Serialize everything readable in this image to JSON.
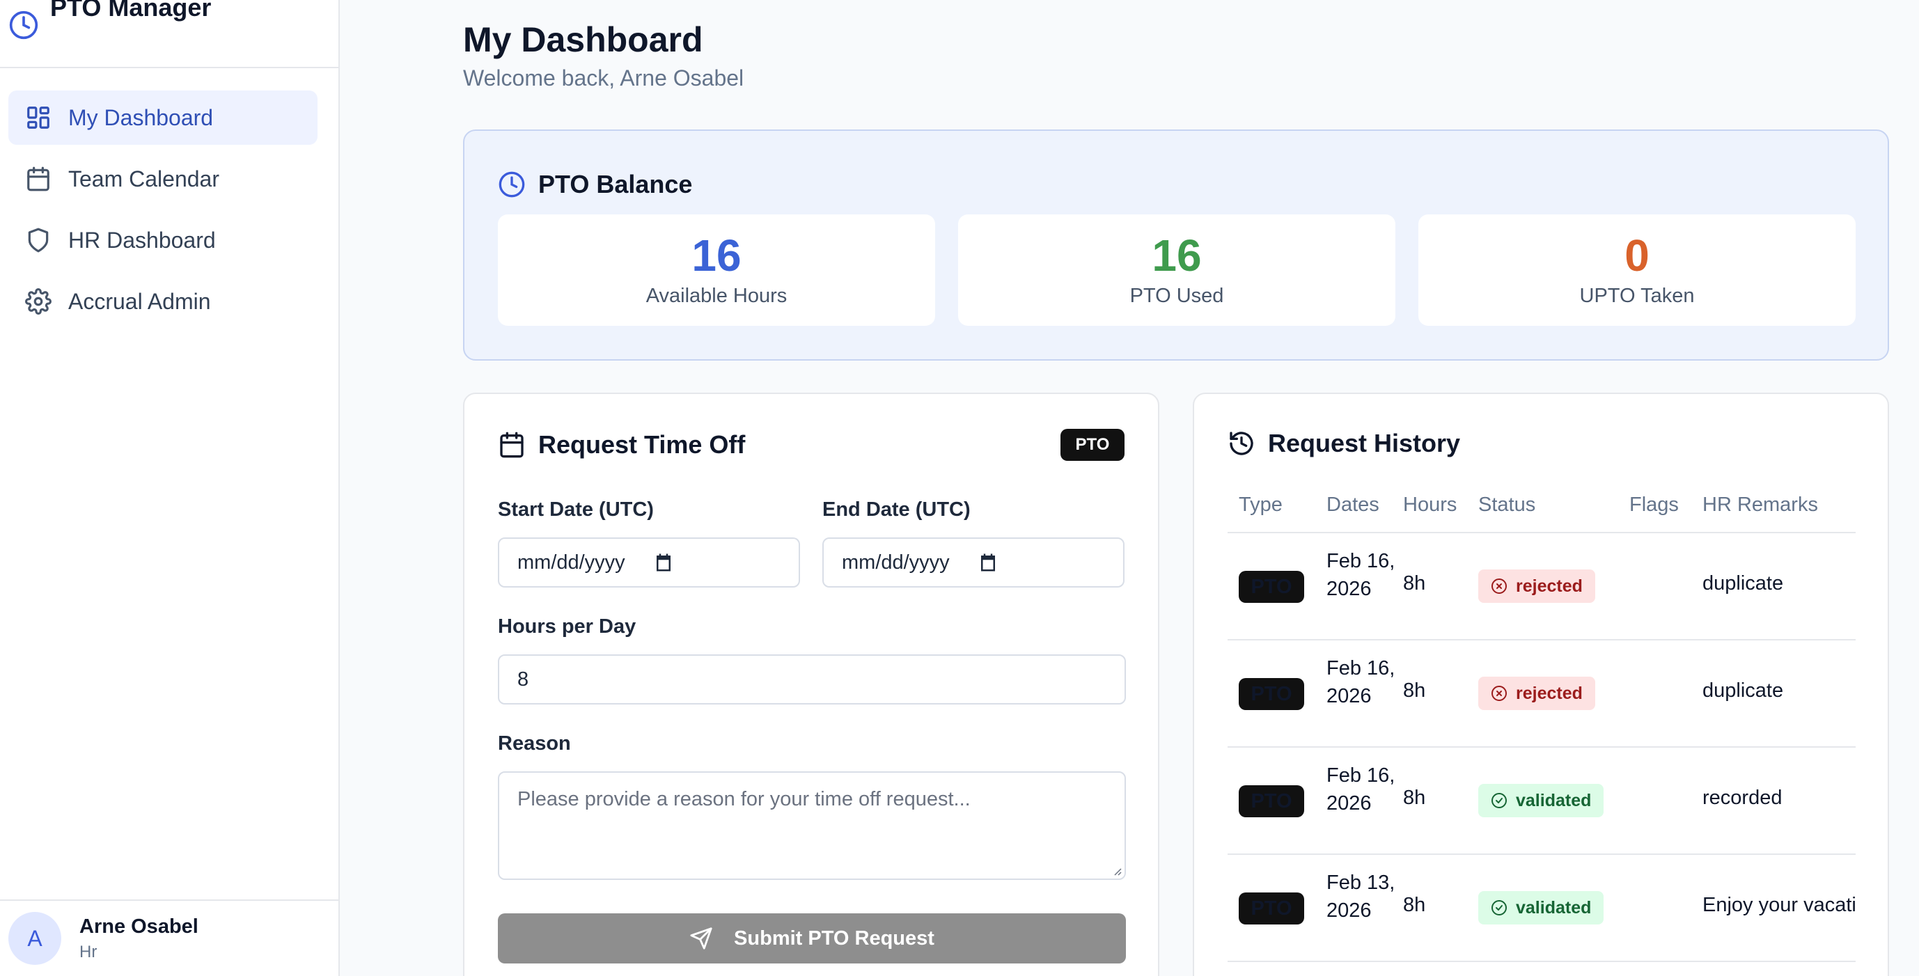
{
  "app": {
    "title": "PTO Manager"
  },
  "sidebar": {
    "items": [
      {
        "label": "My Dashboard",
        "icon": "dashboard-grid-icon",
        "active": true
      },
      {
        "label": "Team Calendar",
        "icon": "calendar-icon",
        "active": false
      },
      {
        "label": "HR Dashboard",
        "icon": "shield-icon",
        "active": false
      },
      {
        "label": "Accrual Admin",
        "icon": "gear-icon",
        "active": false
      }
    ],
    "user": {
      "initial": "A",
      "name": "Arne Osabel",
      "role": "Hr"
    }
  },
  "header": {
    "title": "My Dashboard",
    "subtitle": "Welcome back, Arne Osabel"
  },
  "balance": {
    "title": "PTO Balance",
    "stats": [
      {
        "value": "16",
        "label": "Available Hours",
        "color": "#3b63d6"
      },
      {
        "value": "16",
        "label": "PTO Used",
        "color": "#3f9b4d"
      },
      {
        "value": "0",
        "label": "UPTO Taken",
        "color": "#d9622b"
      }
    ]
  },
  "request_form": {
    "title": "Request Time Off",
    "type_badge": "PTO",
    "start_label": "Start Date (UTC)",
    "start_placeholder": "mm/dd/yyyy",
    "end_label": "End Date (UTC)",
    "end_placeholder": "mm/dd/yyyy",
    "hours_label": "Hours per Day",
    "hours_value": "8",
    "reason_label": "Reason",
    "reason_placeholder": "Please provide a reason for your time off request...",
    "submit_label": "Submit PTO Request"
  },
  "history": {
    "title": "Request History",
    "columns": [
      "Type",
      "Dates",
      "Hours",
      "Status",
      "Flags",
      "HR Remarks"
    ],
    "rows": [
      {
        "type": "PTO",
        "dates": "Feb 16, 2026",
        "hours": "8h",
        "status": "rejected",
        "flags": "",
        "remarks": "duplicate"
      },
      {
        "type": "PTO",
        "dates": "Feb 16, 2026",
        "hours": "8h",
        "status": "rejected",
        "flags": "",
        "remarks": "duplicate"
      },
      {
        "type": "PTO",
        "dates": "Feb 16, 2026",
        "hours": "8h",
        "status": "validated",
        "flags": "",
        "remarks": "recorded"
      },
      {
        "type": "PTO",
        "dates": "Feb 13, 2026",
        "hours": "8h",
        "status": "validated",
        "flags": "",
        "remarks": "Enjoy your vacati"
      }
    ]
  }
}
